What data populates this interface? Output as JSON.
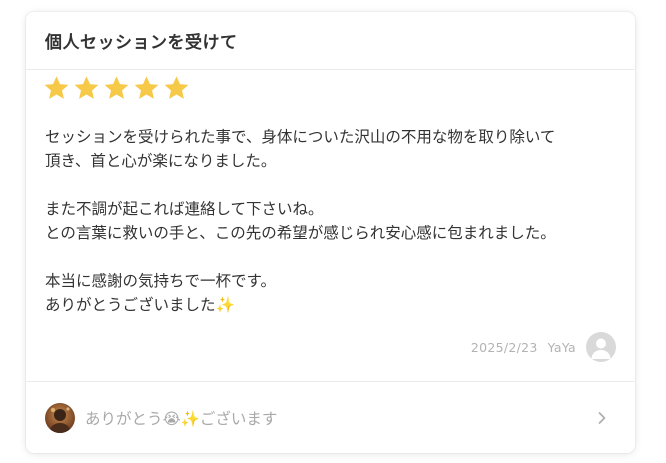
{
  "review": {
    "title": "個人セッションを受けて",
    "rating": 5,
    "rating_max": 5,
    "star_color": "#f7c948",
    "paragraphs": [
      "セッションを受けられた事で、身体についた沢山の不用な物を取り除いて\n頂き、首と心が楽になりました。",
      "また不調が起これば連絡して下さいね。\nとの言葉に救いの手と、この先の希望が感じられ安心感に包まれました。",
      "本当に感謝の気持ちで一杯です。\nありがとうございました✨"
    ],
    "date": "2025/2/23",
    "user_name": "YaYa",
    "user_avatar_icon": "default-user-icon"
  },
  "reply": {
    "text": "ありがとう😭✨ございます",
    "avatar_icon": "reply-author-avatar",
    "chevron_icon": "chevron-right-icon"
  }
}
